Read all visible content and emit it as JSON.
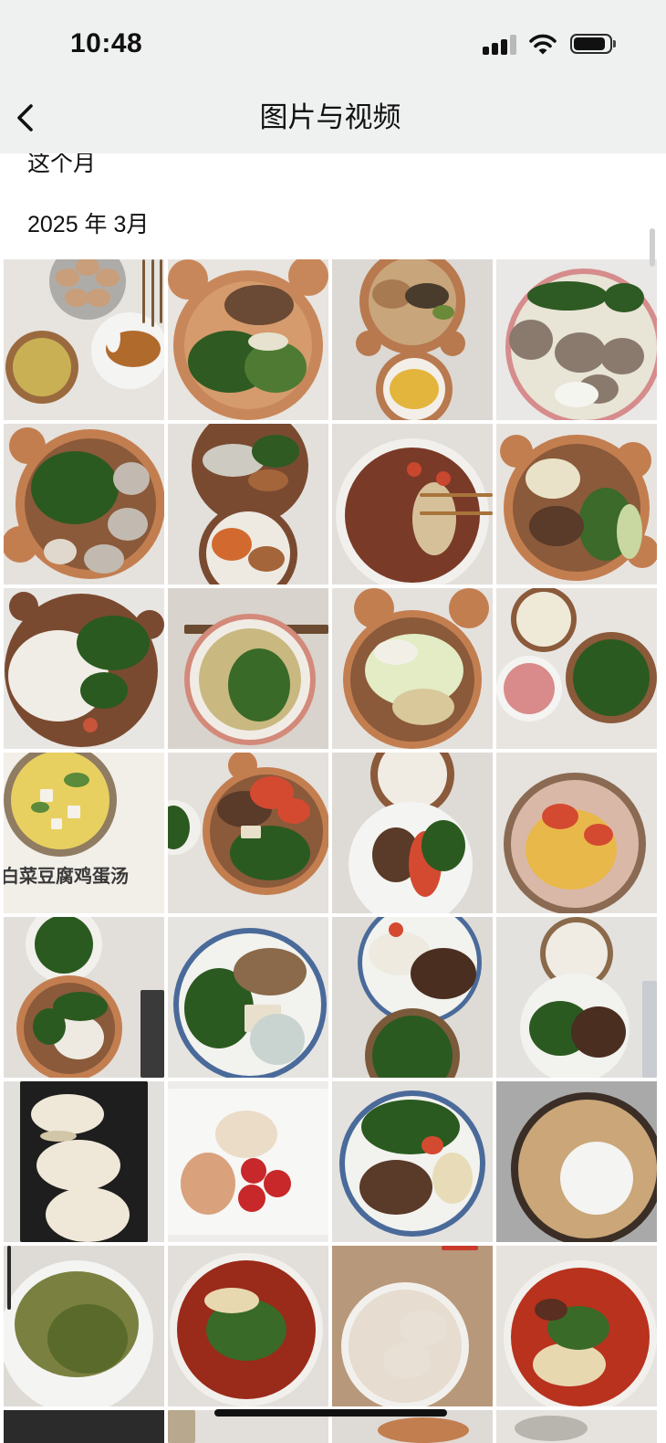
{
  "status_bar": {
    "time": "10:48",
    "signal_strength": 3,
    "signal_max": 4,
    "battery_level": 0.9,
    "icons": [
      "signal-icon",
      "wifi-icon",
      "battery-icon"
    ]
  },
  "nav": {
    "back_icon": "chevron-left-icon",
    "title": "图片与视频"
  },
  "sections": {
    "this_month": "这个月",
    "march_2025": "2025 年 3月"
  },
  "theme": {
    "header_bg": "#eff1f0",
    "page_bg": "#ffffff",
    "text": "#111111",
    "home_indicator": "#111111"
  },
  "photos": [
    {
      "palette": [
        "#e7e4e0",
        "#aeaca8",
        "#c99e7a",
        "#9a6a3e",
        "#c9b055",
        "#f4f4f2",
        "#b06a2c",
        "#7a5a3a"
      ]
    },
    {
      "palette": [
        "#e8e4df",
        "#c8875a",
        "#d59b6c",
        "#2f5a22",
        "#6a4a34",
        "#e6e2cf",
        "#4f7a33"
      ]
    },
    {
      "palette": [
        "#dcd8d3",
        "#b8794f",
        "#c8a57a",
        "#4a3c2c",
        "#6a8a3a",
        "#f3efe8",
        "#e4b53c",
        "#a87a52"
      ]
    },
    {
      "palette": [
        "#e9e8e6",
        "#d68c8c",
        "#e8e4d6",
        "#8a7a6e",
        "#2e5a24",
        "#f5f5ef"
      ]
    },
    {
      "palette": [
        "#e5e1dc",
        "#c37e50",
        "#8b5a3a",
        "#2b5a20",
        "#c2bab0",
        "#e0d8cc"
      ]
    },
    {
      "palette": [
        "#e3e0dc",
        "#7a4a30",
        "#cdcac2",
        "#2f5a22",
        "#d26a30",
        "#eeeae2",
        "#a5653a"
      ]
    },
    {
      "palette": [
        "#e2ded9",
        "#f2f0ec",
        "#7a3a28",
        "#d6c09a",
        "#c9472e",
        "#a8743a"
      ]
    },
    {
      "palette": [
        "#e7e4e0",
        "#c37e50",
        "#8a5a3a",
        "#e9e2c8",
        "#3b6a2a",
        "#5a3a28",
        "#c8d8a0"
      ]
    },
    {
      "palette": [
        "#e8e6e2",
        "#7a4a30",
        "#f0ede6",
        "#2b5a20",
        "#c8543a"
      ]
    },
    {
      "palette": [
        "#d8d3cc",
        "#f0ece5",
        "#d38a7a",
        "#c9b980",
        "#3a6a28",
        "#6a4a30"
      ]
    },
    {
      "palette": [
        "#e4e1dd",
        "#8a5a3a",
        "#c37e50",
        "#e3ecc4",
        "#d8c89a",
        "#f2f0e6"
      ]
    },
    {
      "palette": [
        "#e8e5e1",
        "#8a5a3a",
        "#efe9d8",
        "#d98a8a",
        "#2b5a20",
        "#f4f4f2"
      ]
    },
    {
      "palette": [
        "#f2eee8",
        "#8f7c62",
        "#e8d060",
        "#f4f2ea",
        "#5a8a3a"
      ],
      "caption": "白菜豆腐鸡蛋汤"
    },
    {
      "palette": [
        "#e4e1dc",
        "#c37e50",
        "#8a5a3a",
        "#d44a30",
        "#2b5a20",
        "#e8e0c8",
        "#5a3a28",
        "#f2f0ec"
      ]
    },
    {
      "palette": [
        "#dedad5",
        "#8a5a3a",
        "#f0ece4",
        "#f4f4f2",
        "#5a3a28",
        "#d44a30",
        "#2b5a20"
      ]
    },
    {
      "palette": [
        "#e6e3de",
        "#8a6a52",
        "#d9b8a8",
        "#d44a30",
        "#e8b84a"
      ]
    },
    {
      "palette": [
        "#e2dfda",
        "#f2f0ec",
        "#2b5a20",
        "#8a5a3a",
        "#c37e50",
        "#eeeae2",
        "#3a3a3a"
      ]
    },
    {
      "palette": [
        "#e6e4e0",
        "#4a6a9a",
        "#f2f2ee",
        "#2b5a20",
        "#e8e0cc",
        "#8a6a4a",
        "#c9d4d0"
      ]
    },
    {
      "palette": [
        "#dedbd6",
        "#f2f2ee",
        "#4a6a9a",
        "#eeeae0",
        "#4a2e20",
        "#d44a30",
        "#2b5a20",
        "#7a5a3a"
      ]
    },
    {
      "palette": [
        "#e4e2df",
        "#8a6a4a",
        "#f0ece4",
        "#f2f2ee",
        "#2b5a20",
        "#4a2e20",
        "#c9ccd0"
      ]
    },
    {
      "palette": [
        "#e2e0dd",
        "#1e1e1e",
        "#efe8d8",
        "#d2c6a8"
      ]
    },
    {
      "palette": [
        "#edecea",
        "#f7f7f5",
        "#ebdcc8",
        "#d9a27c",
        "#c8282a"
      ]
    },
    {
      "palette": [
        "#e4e2de",
        "#4a6a9a",
        "#f2f2ee",
        "#2b5a20",
        "#5a3a28",
        "#d44a30",
        "#e8dcb8"
      ]
    },
    {
      "palette": [
        "#a9a9a9",
        "#3a2e26",
        "#caa678",
        "#f4f4f2"
      ]
    },
    {
      "palette": [
        "#dedbd6",
        "#f4f4f2",
        "#7a8040",
        "#5a6a2a",
        "#2a2a2a"
      ]
    },
    {
      "palette": [
        "#e2dfdb",
        "#f2f0ec",
        "#9a2a1a",
        "#3a6a28",
        "#e8d8b0"
      ]
    },
    {
      "palette": [
        "#b8987a",
        "#f2f0ec",
        "#e6dccf",
        "#e8e0d4",
        "#c83a2a"
      ]
    },
    {
      "palette": [
        "#e6e3df",
        "#f2f0ec",
        "#b8321e",
        "#3a6a28",
        "#e8d8b0",
        "#5a2e20"
      ]
    },
    {
      "palette": [
        "#2b2b2b"
      ]
    },
    {
      "palette": [
        "#e2dfdb",
        "#b8a88e"
      ]
    },
    {
      "palette": [
        "#dedad5",
        "#c37e50"
      ]
    },
    {
      "palette": [
        "#e6e3df",
        "#b8b4ae"
      ]
    }
  ]
}
